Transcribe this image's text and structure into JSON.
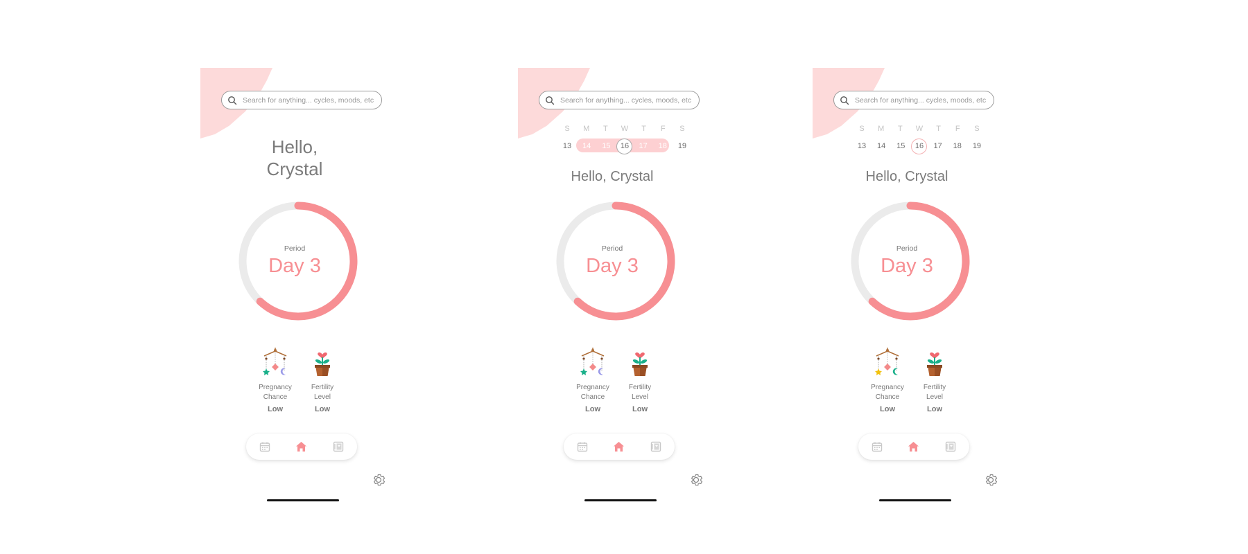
{
  "search": {
    "placeholder": "Search for anything... cycles, moods, etc."
  },
  "greeting": {
    "line1": "Hello,",
    "line2": "Crystal",
    "full": "Hello, Crystal"
  },
  "cycle": {
    "phase": "Period",
    "day_text": "Day 3",
    "progress": 0.62
  },
  "week": {
    "days": [
      "S",
      "M",
      "T",
      "W",
      "T",
      "F",
      "S"
    ],
    "dates": [
      "13",
      "14",
      "15",
      "16",
      "17",
      "18",
      "19"
    ],
    "today": "16"
  },
  "metrics": {
    "pregnancy": {
      "label_1": "Pregnancy",
      "label_2": "Chance",
      "value": "Low"
    },
    "fertility": {
      "label_1": "Fertility",
      "label_2": "Level",
      "value": "Low"
    }
  },
  "nav": {
    "items": [
      "calendar-icon",
      "home-icon",
      "journal-icon"
    ],
    "active": "home-icon"
  },
  "colors": {
    "accent": "#f78f93",
    "corner": "#fddada",
    "band": "#fdd0d2",
    "ring_track": "#ebebeb"
  }
}
